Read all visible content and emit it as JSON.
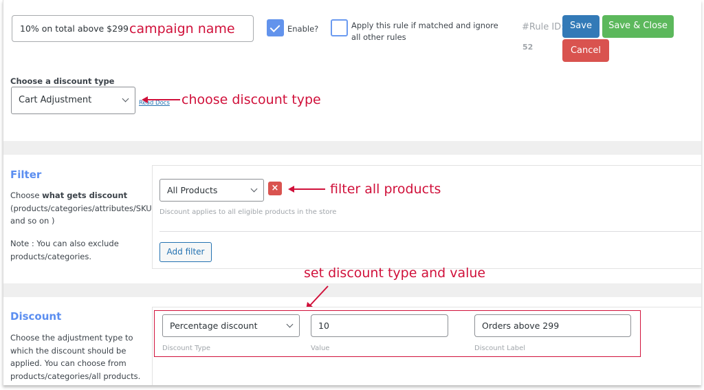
{
  "header": {
    "campaign_name_value": "10% on total above $299",
    "enable_checkbox": {
      "label": "Enable?",
      "checked": true
    },
    "exclusive_checkbox": {
      "label": "Apply this rule if matched and ignore all other rules",
      "checked": false
    },
    "rule_id_label": "#Rule ID:",
    "rule_id_value": "52",
    "buttons": {
      "save": "Save",
      "save_close": "Save & Close",
      "cancel": "Cancel"
    }
  },
  "discount_type": {
    "label": "Choose a discount type",
    "selected": "Cart Adjustment",
    "read_docs": "Read Docs"
  },
  "filter": {
    "title": "Filter",
    "desc_prefix": "Choose ",
    "desc_bold": "what gets discount",
    "desc_rest": "(products/categories/attributes/SKU and so on )",
    "note": "Note : You can also exclude products/categories.",
    "selected": "All Products",
    "remove_icon": "×",
    "hint": "Discount applies to all eligible products in the store",
    "add_filter": "Add filter"
  },
  "discount": {
    "title": "Discount",
    "desc": "Choose the adjustment type to which the discount should be applied. You can choose from products/categories/all products.",
    "type_selected": "Percentage discount",
    "value": "10",
    "label_value": "Orders above 299",
    "hints": {
      "type": "Discount Type",
      "value": "Value",
      "label": "Discount Label"
    }
  },
  "annotations": {
    "campaign": "campaign name",
    "discount_type": "choose discount type",
    "filter": "filter all products",
    "set_discount": "set discount type and value",
    "color": "#d0103a"
  }
}
